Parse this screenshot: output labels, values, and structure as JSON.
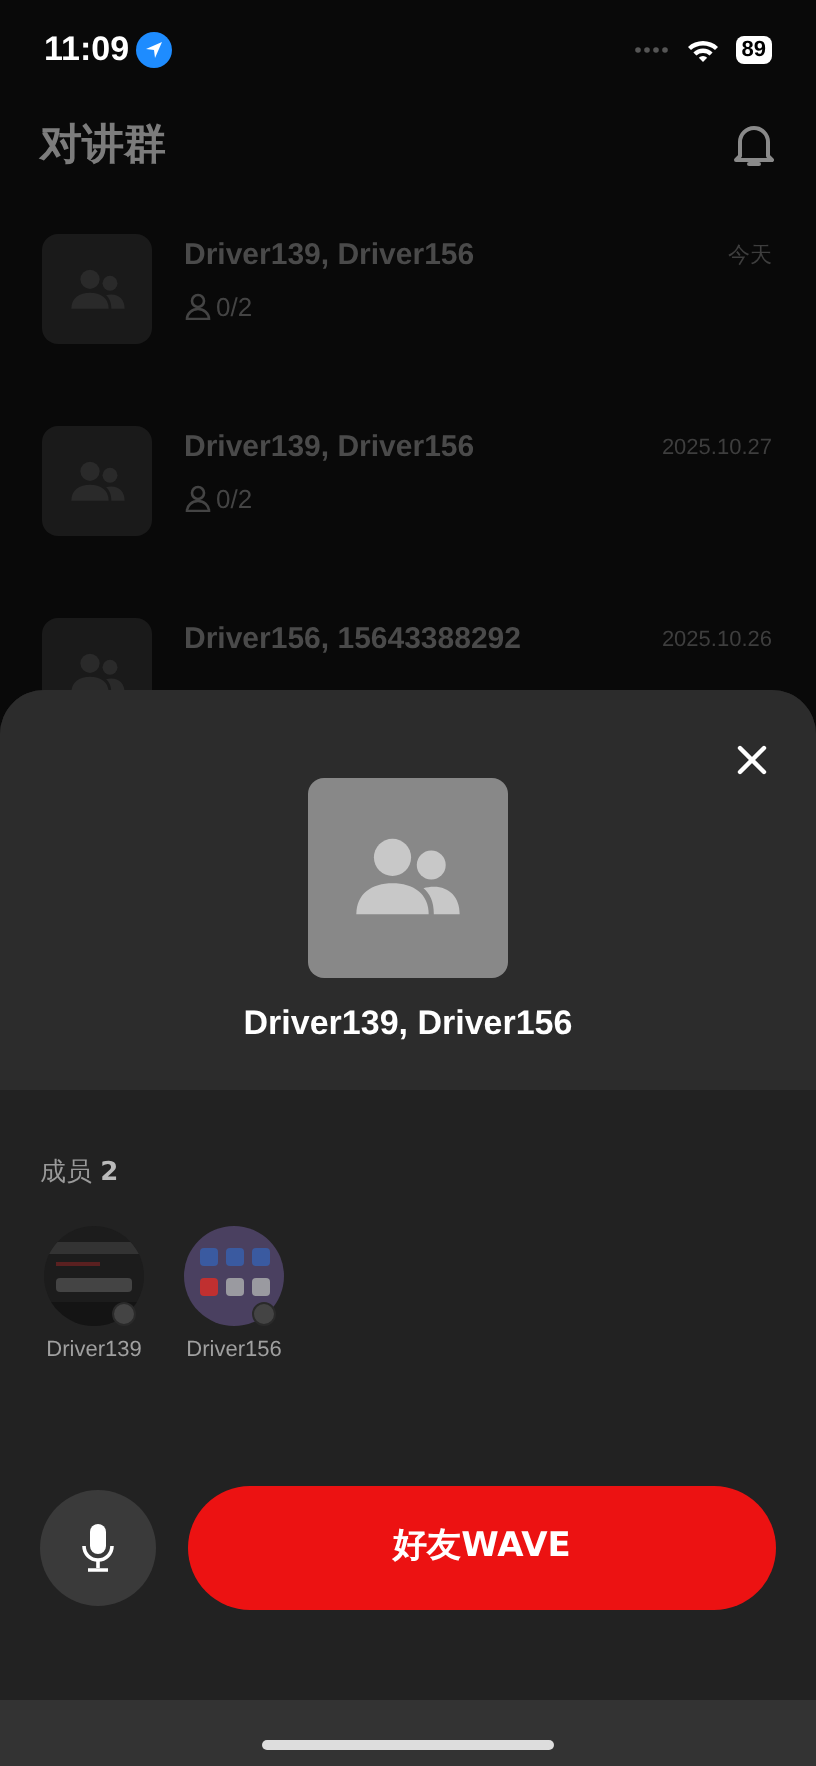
{
  "status_bar": {
    "time": "11:09",
    "battery": "89"
  },
  "header": {
    "title": "对讲群"
  },
  "groups": [
    {
      "name": "Driver139, Driver156",
      "members": "0/2",
      "date": "今天"
    },
    {
      "name": "Driver139, Driver156",
      "members": "0/2",
      "date": "2025.10.27"
    },
    {
      "name": "Driver156, 15643388292",
      "date": "2025.10.26"
    }
  ],
  "sheet": {
    "title": "Driver139, Driver156",
    "members_label": "成员",
    "members_count": "2",
    "members": [
      {
        "name": "Driver139",
        "kind": "picture"
      },
      {
        "name": "Driver156",
        "kind": "picture"
      }
    ],
    "wave_button": "好友WAVE"
  }
}
